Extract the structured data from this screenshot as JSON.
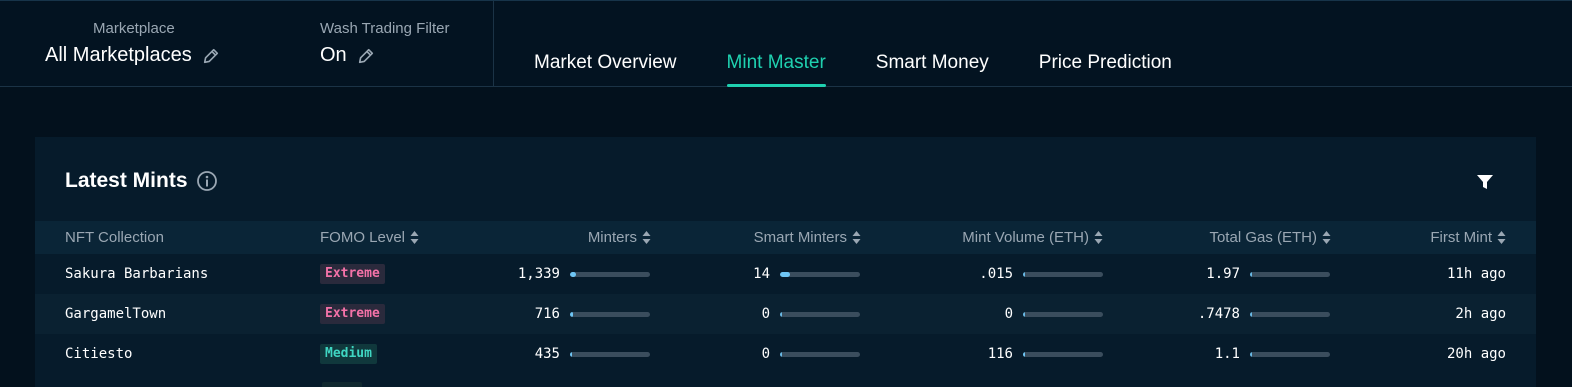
{
  "filters": {
    "marketplace": {
      "label": "Marketplace",
      "value": "All Marketplaces"
    },
    "wash_trading": {
      "label": "Wash Trading Filter",
      "value": "On"
    }
  },
  "tabs": [
    {
      "label": "Market Overview",
      "active": false
    },
    {
      "label": "Mint Master",
      "active": true
    },
    {
      "label": "Smart Money",
      "active": false
    },
    {
      "label": "Price Prediction",
      "active": false
    }
  ],
  "card": {
    "title": "Latest Mints",
    "columns": {
      "collection": "NFT Collection",
      "fomo": "FOMO Level",
      "minters": "Minters",
      "smart_minters": "Smart Minters",
      "mint_volume": "Mint Volume (ETH)",
      "total_gas": "Total Gas (ETH)",
      "first_mint": "First Mint"
    },
    "rows": [
      {
        "collection": "Sakura Barbarians",
        "fomo": "Extreme",
        "fomo_level": "extreme",
        "minters": "1,339",
        "minters_fill": 0.08,
        "smart_minters": "14",
        "smart_fill": 0.12,
        "mint_volume": ".015",
        "volume_fill": 0,
        "total_gas": "1.97",
        "gas_fill": 0,
        "first_mint": "11h ago"
      },
      {
        "collection": "GargamelTown",
        "fomo": "Extreme",
        "fomo_level": "extreme",
        "minters": "716",
        "minters_fill": 0.04,
        "smart_minters": "0",
        "smart_fill": 0,
        "mint_volume": "0",
        "volume_fill": 0,
        "total_gas": ".7478",
        "gas_fill": 0,
        "first_mint": "2h ago"
      },
      {
        "collection": "Citiesto",
        "fomo": "Medium",
        "fomo_level": "medium",
        "minters": "435",
        "minters_fill": 0.02,
        "smart_minters": "0",
        "smart_fill": 0,
        "mint_volume": "116",
        "volume_fill": 0.03,
        "total_gas": "1.1",
        "gas_fill": 0,
        "first_mint": "20h ago"
      }
    ]
  },
  "colors": {
    "accent": "#1fd1b0",
    "bar_fill": "#6ec6f5",
    "extreme": "#f472a8",
    "medium": "#3fd6c2"
  },
  "icons": [
    "pencil-icon",
    "info-icon",
    "filter-icon",
    "sort-icon"
  ]
}
